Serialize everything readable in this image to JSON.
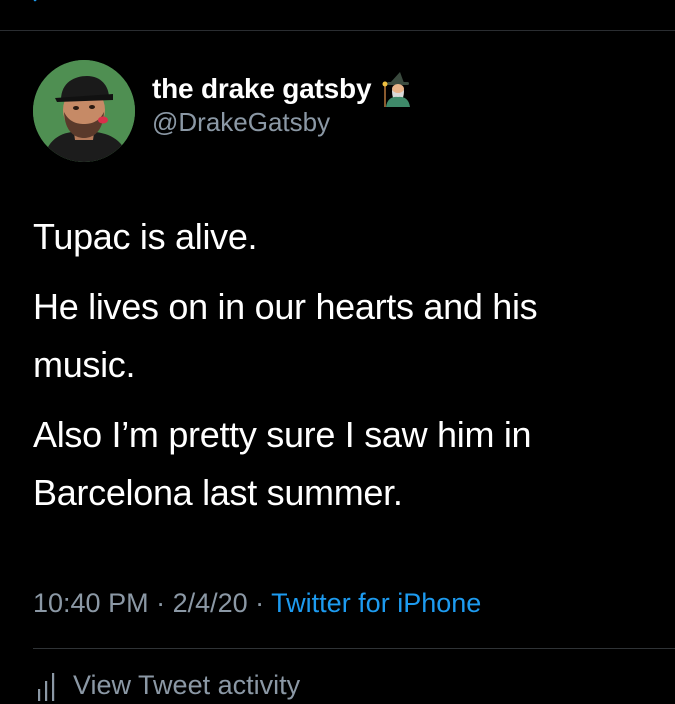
{
  "author": {
    "display_name": "the drake gatsby",
    "handle": "@DrakeGatsby",
    "badge_icon": "mage-emoji-icon",
    "avatar_icon": "cartoon-avatar-icon"
  },
  "tweet": {
    "paragraphs": [
      "Tupac is alive.",
      "He lives on in our hearts and his music.",
      "Also I’m pretty sure I saw him in Barcelona last summer."
    ]
  },
  "meta": {
    "time": "10:40 PM",
    "separator": " · ",
    "date": "2/4/20",
    "source": "Twitter for iPhone"
  },
  "activity": {
    "label": "View Tweet activity",
    "icon": "bar-chart-icon"
  },
  "colors": {
    "background": "#000000",
    "primary_text": "#ffffff",
    "secondary_text": "#8b98a5",
    "link": "#1d9bf0",
    "divider": "#2f3336"
  }
}
